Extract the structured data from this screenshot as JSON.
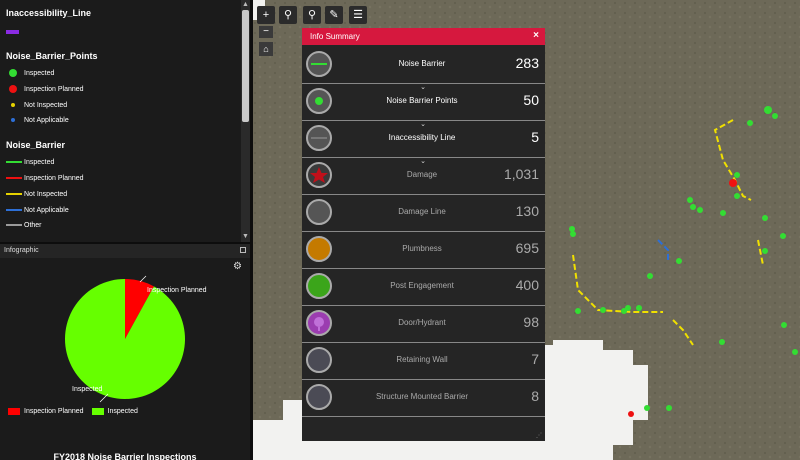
{
  "legend": {
    "inaccessibility_title": "Inaccessibility_Line",
    "points_title": "Noise_Barrier_Points",
    "points_items": [
      {
        "label": "Inspected",
        "color": "#33dd33"
      },
      {
        "label": "Inspection Planned",
        "color": "#ee1111"
      },
      {
        "label": "Not Inspected",
        "color": "#e6d200"
      },
      {
        "label": "Not Applicable",
        "color": "#2d6fd6"
      }
    ],
    "barrier_title": "Noise_Barrier",
    "barrier_items": [
      {
        "label": "Inspected",
        "color": "#33dd33"
      },
      {
        "label": "Inspection Planned",
        "color": "#ee1111"
      },
      {
        "label": "Not Inspected",
        "color": "#e6d200"
      },
      {
        "label": "Not Applicable",
        "color": "#2d6fd6"
      },
      {
        "label": "Other",
        "color": "#9a9a9a"
      }
    ]
  },
  "infographic": {
    "header": "Infographic",
    "settings_icon": "gear-icon",
    "chart_title": "FY2018 Noise Barrier Inspections"
  },
  "chart_data": {
    "type": "pie",
    "title": "FY2018 Noise Barrier Inspections",
    "slices": [
      {
        "label": "Inspection Planned",
        "value": 8,
        "color": "#ff0000"
      },
      {
        "label": "Inspected",
        "value": 92,
        "color": "#66ff00"
      }
    ],
    "legend": [
      "Inspection Planned",
      "Inspected"
    ],
    "legend_position": "bottom-left"
  },
  "map_tools": {
    "zoom_in": "+",
    "zoom_out": "−",
    "search_icon": "search-icon",
    "locate_icon": "locate-icon",
    "measure_icon": "measure-icon",
    "layers_icon": "layers-icon",
    "home_icon": "home-icon"
  },
  "summary": {
    "title": "Info Summary",
    "close": "×",
    "rows": [
      {
        "label": "Noise Barrier",
        "count": "283",
        "active": true,
        "fill": "#555555",
        "glyph_color": "#33dd33"
      },
      {
        "label": "Noise Barrier Points",
        "count": "50",
        "active": true,
        "fill": "#555555",
        "glyph_color": "#33dd33"
      },
      {
        "label": "Inaccessibility Line",
        "count": "5",
        "active": true,
        "fill": "#555555",
        "glyph_color": "#777777"
      },
      {
        "label": "Damage",
        "count": "1,031",
        "active": false,
        "fill": "#3a3a3a",
        "glyph_color": "#c0101a"
      },
      {
        "label": "Damage Line",
        "count": "130",
        "active": false,
        "fill": "#555555",
        "glyph_color": "#555555"
      },
      {
        "label": "Plumbness",
        "count": "695",
        "active": false,
        "fill": "#c47a00",
        "glyph_color": "#c47a00"
      },
      {
        "label": "Post Engagement",
        "count": "400",
        "active": false,
        "fill": "#3ba51a",
        "glyph_color": "#3ba51a"
      },
      {
        "label": "Door/Hydrant",
        "count": "98",
        "active": false,
        "fill": "#9b3db0",
        "glyph_color": "#9b3db0"
      },
      {
        "label": "Retaining Wall",
        "count": "7",
        "active": false,
        "fill": "#4b4b55",
        "glyph_color": "#4b4b55"
      },
      {
        "label": "Structure Mounted Barrier",
        "count": "8",
        "active": false,
        "fill": "#4b4b55",
        "glyph_color": "#4b4b55"
      }
    ]
  }
}
